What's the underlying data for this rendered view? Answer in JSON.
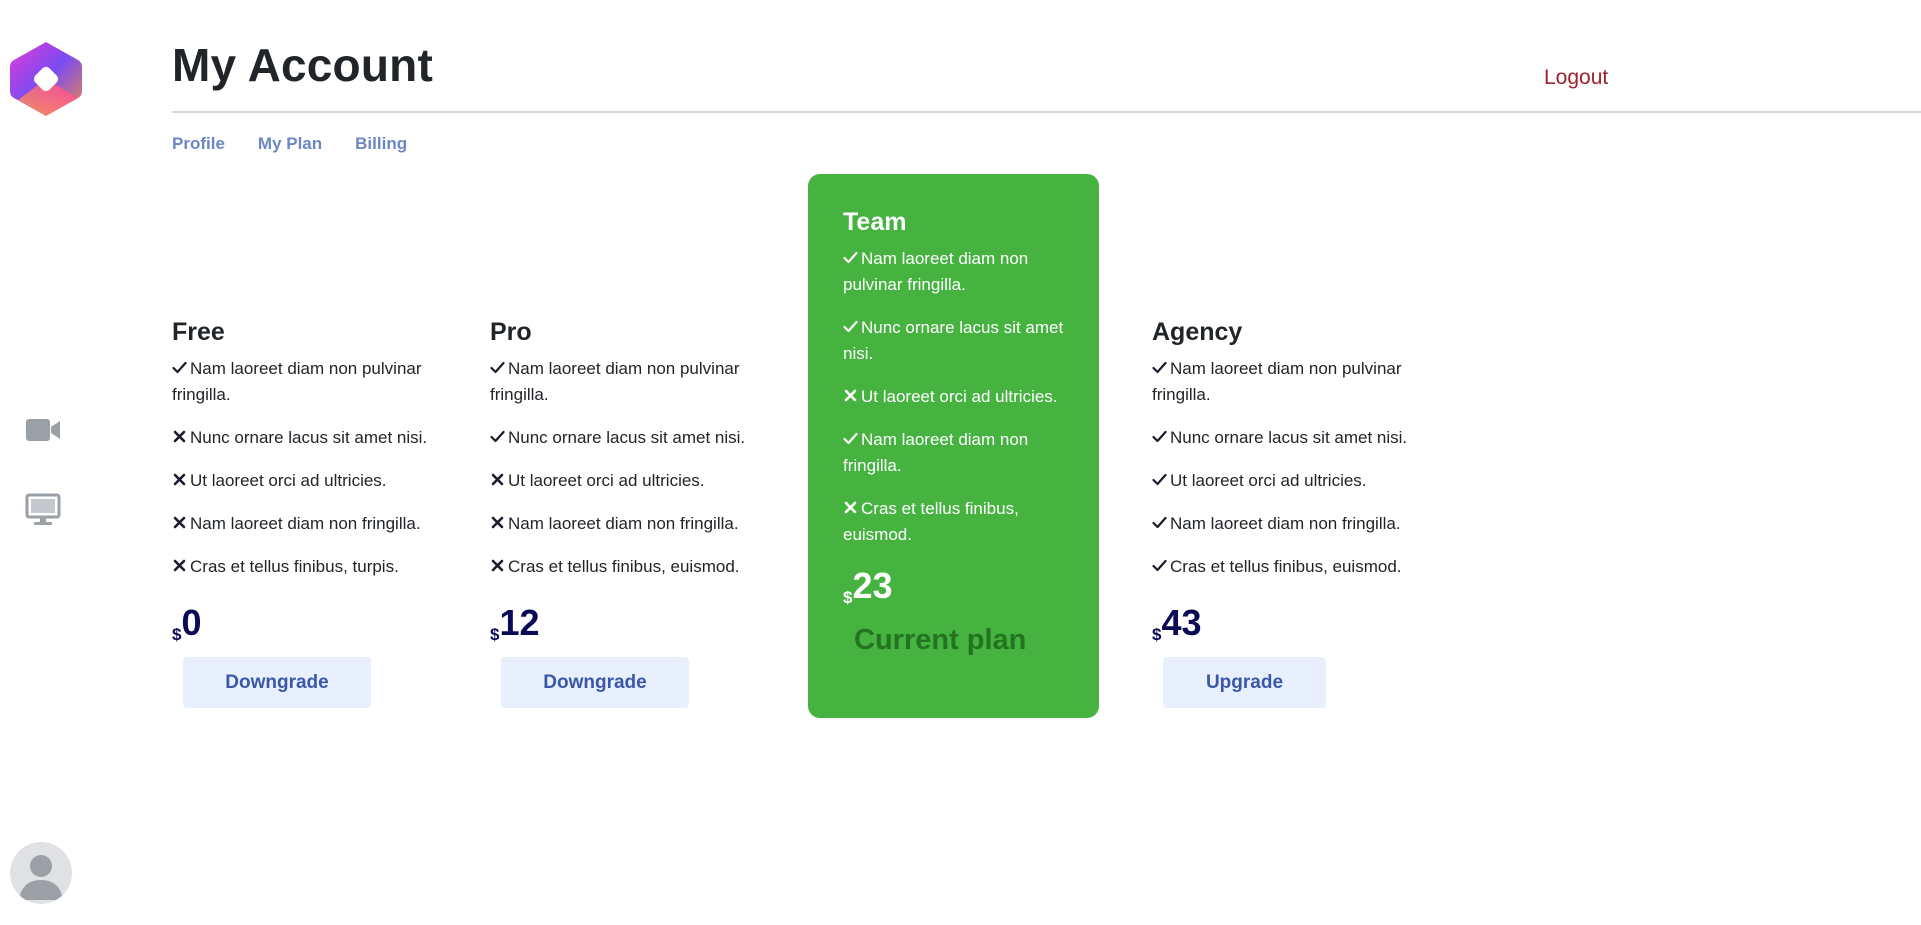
{
  "header": {
    "title": "My Account",
    "logout_label": "Logout"
  },
  "tabs": [
    {
      "label": "Profile"
    },
    {
      "label": "My Plan"
    },
    {
      "label": "Billing"
    }
  ],
  "sidebar": {
    "icons": [
      "logo-icon",
      "video-camera-icon",
      "desktop-monitor-icon",
      "user-avatar-icon"
    ]
  },
  "plans": [
    {
      "name": "Free",
      "features": [
        {
          "mark": "check",
          "text": "Nam laoreet diam non pulvinar fringilla."
        },
        {
          "mark": "cross",
          "text": "Nunc ornare lacus sit amet nisi."
        },
        {
          "mark": "cross",
          "text": "Ut laoreet orci ad ultricies."
        },
        {
          "mark": "cross",
          "text": "Nam laoreet diam non fringilla."
        },
        {
          "mark": "cross",
          "text": "Cras et tellus finibus, turpis."
        }
      ],
      "currency": "$",
      "price": "0",
      "action_label": "Downgrade"
    },
    {
      "name": "Pro",
      "features": [
        {
          "mark": "check",
          "text": "Nam laoreet diam non pulvinar fringilla."
        },
        {
          "mark": "check",
          "text": "Nunc ornare lacus sit amet nisi."
        },
        {
          "mark": "cross",
          "text": "Ut laoreet orci ad ultricies."
        },
        {
          "mark": "cross",
          "text": "Nam laoreet diam non fringilla."
        },
        {
          "mark": "cross",
          "text": "Cras et tellus finibus, euismod."
        }
      ],
      "currency": "$",
      "price": "12",
      "action_label": "Downgrade"
    },
    {
      "name": "Team",
      "features": [
        {
          "mark": "check",
          "text": "Nam laoreet diam non pulvinar fringilla."
        },
        {
          "mark": "check",
          "text": "Nunc ornare lacus sit amet nisi."
        },
        {
          "mark": "cross",
          "text": "Ut laoreet orci ad ultricies."
        },
        {
          "mark": "check",
          "text": "Nam laoreet diam non fringilla."
        },
        {
          "mark": "cross",
          "text": "Cras et tellus finibus, euismod."
        }
      ],
      "currency": "$",
      "price": "23",
      "current_label": "Current plan"
    },
    {
      "name": "Agency",
      "features": [
        {
          "mark": "check",
          "text": "Nam laoreet diam non pulvinar fringilla."
        },
        {
          "mark": "check",
          "text": "Nunc ornare lacus sit amet nisi."
        },
        {
          "mark": "check",
          "text": "Ut laoreet orci ad ultricies."
        },
        {
          "mark": "check",
          "text": "Nam laoreet diam non fringilla."
        },
        {
          "mark": "check",
          "text": "Cras et tellus finibus, euismod."
        }
      ],
      "currency": "$",
      "price": "43",
      "action_label": "Upgrade"
    }
  ],
  "colors": {
    "current_plan_bg": "#46b341",
    "current_plan_label": "#22741f",
    "button_bg": "#e8f0fd",
    "button_text": "#3b57a8",
    "price_text": "#0a0a55",
    "tab_text": "#6d86c4",
    "logout_text": "#a0222a"
  }
}
